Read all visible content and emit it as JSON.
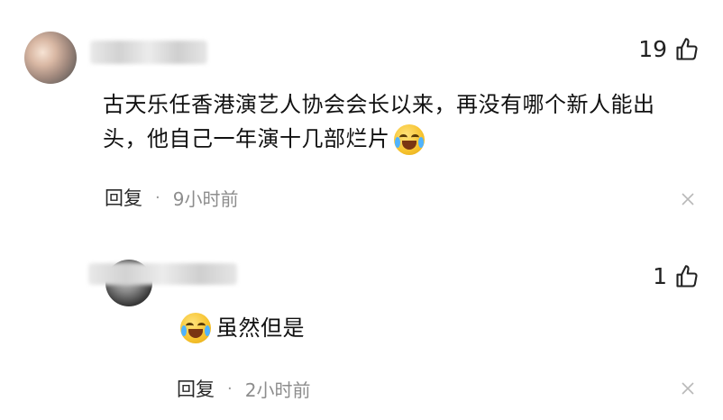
{
  "comments": [
    {
      "likes": "19",
      "text": "古天乐任香港演艺人协会会长以来，再没有哪个新人能出头，他自己一年演十几部烂片",
      "emoji": "laughing-crying-emoji",
      "reply_label": "回复",
      "separator": "·",
      "time": "9小时前"
    },
    {
      "likes": "1",
      "text": "虽然但是",
      "emoji": "crying-emoji",
      "reply_label": "回复",
      "separator": "·",
      "time": "2小时前"
    }
  ],
  "icons": {
    "like": "thumbs-up-icon",
    "close": "close-icon"
  }
}
